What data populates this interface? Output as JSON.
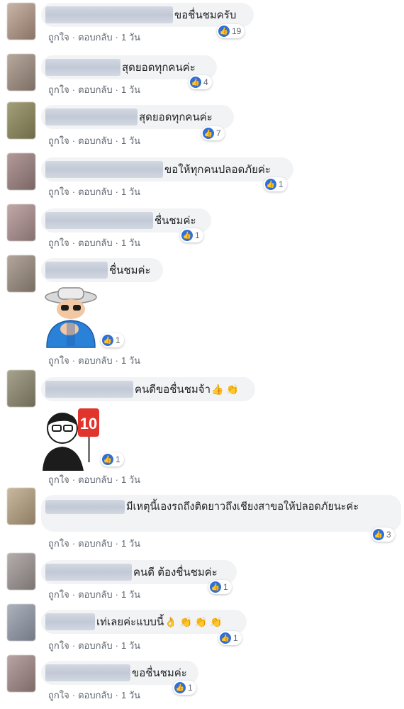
{
  "icons": {
    "like": "like-thumb-icon"
  },
  "comments": [
    {
      "text": "ขอชื่นชมครับ",
      "reactions": "19",
      "like": "ถูกใจ",
      "dot": "·",
      "reply": "ตอบกลับ",
      "dot2": "·",
      "time": "1 วัน"
    },
    {
      "text": "สุดยอดทุกคนค่ะ",
      "reactions": "4",
      "like": "ถูกใจ",
      "dot": "·",
      "reply": "ตอบกลับ",
      "dot2": "·",
      "time": "1 วัน"
    },
    {
      "text": "สุดยอดทุกคนค่ะ",
      "reactions": "7",
      "like": "ถูกใจ",
      "dot": "·",
      "reply": "ตอบกลับ",
      "dot2": "·",
      "time": "1 วัน"
    },
    {
      "text": "ขอให้ทุกคนปลอดภัยค่ะ",
      "reactions": "1",
      "like": "ถูกใจ",
      "dot": "·",
      "reply": "ตอบกลับ",
      "dot2": "·",
      "time": "1 วัน"
    },
    {
      "text": "ชื่นชมค่ะ",
      "reactions": "1",
      "like": "ถูกใจ",
      "dot": "·",
      "reply": "ตอบกลับ",
      "dot2": "·",
      "time": "1 วัน"
    },
    {
      "text": "ชื่นชมค่ะ",
      "reactions": "1",
      "like": "ถูกใจ",
      "dot": "·",
      "reply": "ตอบกลับ",
      "dot2": "·",
      "time": "1 วัน"
    },
    {
      "text": "คนดีขอชื่นชมจ้า",
      "emoji": "👍 👏",
      "reactions": "1",
      "sign": "10",
      "like": "ถูกใจ",
      "dot": "·",
      "reply": "ตอบกลับ",
      "dot2": "·",
      "time": "1 วัน"
    },
    {
      "text": "มีเหตุนี้เองรถถึงติดยาวถึงเชียงสาขอให้ปลอดภัยนะค่ะ",
      "reactions": "3",
      "like": "ถูกใจ",
      "dot": "·",
      "reply": "ตอบกลับ",
      "dot2": "·",
      "time": "1 วัน"
    },
    {
      "text": "คนดี ต้องชื่นชมค่ะ",
      "reactions": "1",
      "like": "ถูกใจ",
      "dot": "·",
      "reply": "ตอบกลับ",
      "dot2": "·",
      "time": "1 วัน"
    },
    {
      "text": "เท่เลยค่ะแบบนี้",
      "emoji": "👌 👏 👏 👏",
      "reactions": "1",
      "like": "ถูกใจ",
      "dot": "·",
      "reply": "ตอบกลับ",
      "dot2": "·",
      "time": "1 วัน"
    },
    {
      "text": "ขอชื่นชมค่ะ",
      "reactions": "1",
      "like": "ถูกใจ",
      "dot": "·",
      "reply": "ตอบกลับ",
      "dot2": "·",
      "time": "1 วัน"
    }
  ]
}
